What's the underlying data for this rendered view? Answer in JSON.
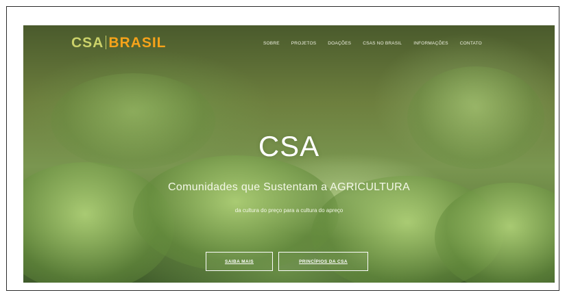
{
  "logo": {
    "left_text": "CSA",
    "right_text": "BRASIL"
  },
  "nav": {
    "items": [
      {
        "label": "SOBRE"
      },
      {
        "label": "PROJETOS"
      },
      {
        "label": "DOAÇÕES"
      },
      {
        "label": "CSAS NO BRASIL"
      },
      {
        "label": "INFORMAÇÕES"
      },
      {
        "label": "CONTATO"
      }
    ]
  },
  "hero": {
    "title": "CSA",
    "subtitle": "Comunidades que Sustentam a AGRICULTURA",
    "tagline": "da cultura do preço para a cultura do apreço",
    "buttons": {
      "more": "SAIBA MAIS",
      "principles": "PRINCÍPIOS DA CSA"
    }
  },
  "colors": {
    "logo_csa": "#cbd26a",
    "logo_brasil": "#f6a31a",
    "hero_bg": "#6d7f3e"
  }
}
